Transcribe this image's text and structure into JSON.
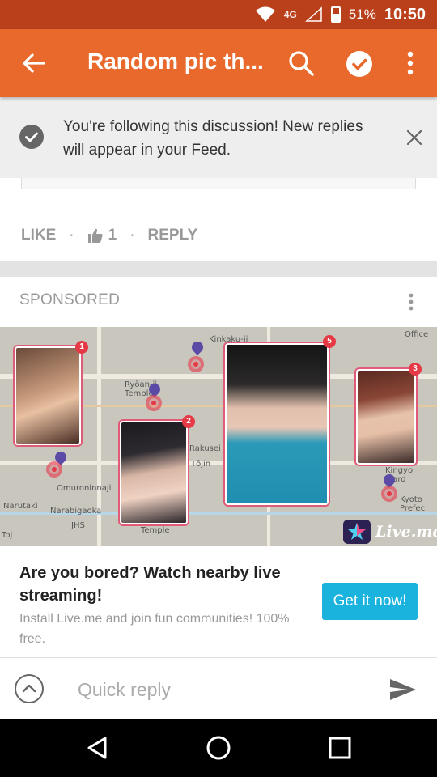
{
  "status_bar": {
    "network": "4G",
    "battery": "51%",
    "time": "10:50",
    "icons": [
      "wifi-icon",
      "signal-icon",
      "battery-icon"
    ]
  },
  "app_bar": {
    "title": "Random pic th...",
    "icons": [
      "back-arrow-icon",
      "search-icon",
      "follow-check-icon",
      "more-vert-icon"
    ],
    "color": "#e9692c"
  },
  "follow_banner": {
    "message": "You're following this discussion! New replies will appear in your Feed.",
    "icons": [
      "check-circle-icon",
      "close-icon"
    ]
  },
  "comment": {
    "like_label": "LIKE",
    "like_count": "1",
    "reply_label": "REPLY"
  },
  "ad": {
    "sponsored_label": "SPONSORED",
    "image": {
      "brand": "Live.me",
      "badges": [
        "1",
        "2",
        "5",
        "3"
      ],
      "map_labels": [
        "Kinkaku-ji",
        "Ryōan-ji Temple",
        "Tōjin",
        "Rakusei Hi",
        "Omuroninnaji",
        "Narutaki",
        "Narabigaoka",
        "JHS",
        "Temple",
        "Kyoto Prefec",
        "Kingyo Ward",
        "Office",
        "Toj"
      ]
    },
    "headline": "Are you bored? Watch nearby live streaming!",
    "description": "Install Live.me and join fun communities! 100% free.",
    "cta": "Get it now!",
    "cta_color": "#19b3de"
  },
  "quick_reply": {
    "placeholder": "Quick reply",
    "icons": [
      "expand-up-icon",
      "send-icon"
    ]
  },
  "nav_bar": {
    "icons": [
      "back-triangle-icon",
      "home-circle-icon",
      "recents-square-icon"
    ]
  }
}
